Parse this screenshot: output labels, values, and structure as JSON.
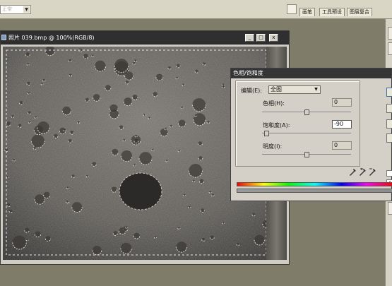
{
  "options_bar": {
    "mode_select": "正常",
    "palette_tabs": [
      "画笔",
      "工具预设",
      "图层复合"
    ]
  },
  "document": {
    "title": "照片 039.bmp @ 100%(RGB/8)",
    "buttons": {
      "minimize": "_",
      "maximize": "□",
      "close": "x"
    }
  },
  "hue_saturation": {
    "title": "色相/饱和度",
    "edit_label": "编辑(E):",
    "edit_value": "全图",
    "hue": {
      "label": "色相(H):",
      "value": "0",
      "level": 0.5
    },
    "saturation": {
      "label": "饱和度(A):",
      "value": "-90",
      "level": 0.05
    },
    "lightness": {
      "label": "明度(I):",
      "value": "0",
      "level": 0.5
    },
    "preview_checked": true,
    "preview_mark": "✓"
  },
  "colors": {
    "accent": "#3a6ea5",
    "titlebar": "#2f2f2f",
    "workspace": "#7f7c6a"
  }
}
